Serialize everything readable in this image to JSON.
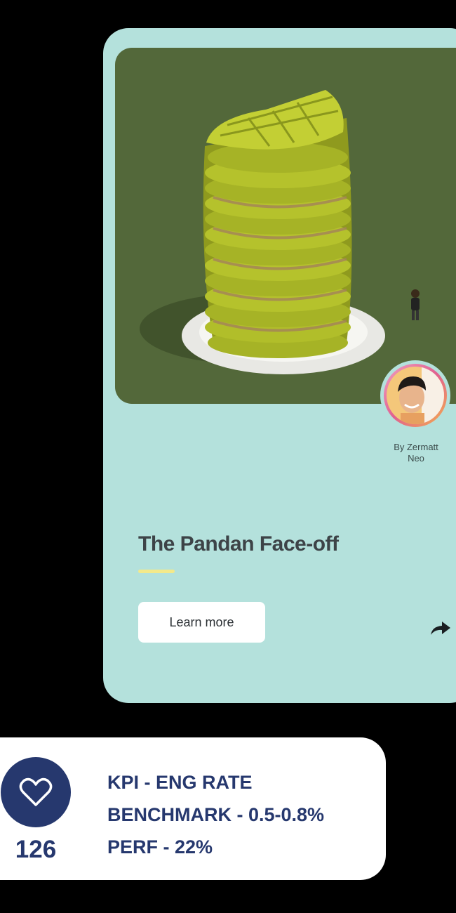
{
  "card": {
    "title": "The Pandan Face-off",
    "author_line1": "By Zermatt",
    "author_line2": "Neo",
    "learn_more_label": "Learn more",
    "hero_icon": "waffle-stack-image",
    "share_icon": "share-arrow-icon"
  },
  "stats": {
    "like_icon": "heart-icon",
    "like_count": "126",
    "lines": [
      "KPI - ENG RATE",
      "BENCHMARK - 0.5-0.8%",
      "PERF - 22%"
    ]
  },
  "colors": {
    "card_bg": "#b4e1dc",
    "hero_bg": "#53683a",
    "accent_underline": "#f3e98a",
    "navy": "#26386e"
  }
}
